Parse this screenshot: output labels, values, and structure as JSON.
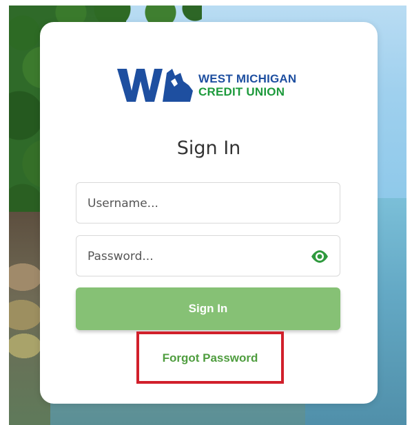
{
  "brand": {
    "name_line1": "WEST MICHIGAN",
    "name_line2": "CREDIT UNION",
    "colors": {
      "blue": "#1e4fa0",
      "green": "#1d9a3c"
    }
  },
  "signin": {
    "title": "Sign In",
    "username_placeholder": "Username...",
    "password_placeholder": "Password...",
    "button_label": "Sign In",
    "forgot_label": "Forgot Password"
  },
  "icons": {
    "password_toggle": "eye-icon"
  },
  "colors": {
    "button_bg": "#86c175",
    "link": "#4f9d3f",
    "highlight_box": "#d1202b"
  }
}
